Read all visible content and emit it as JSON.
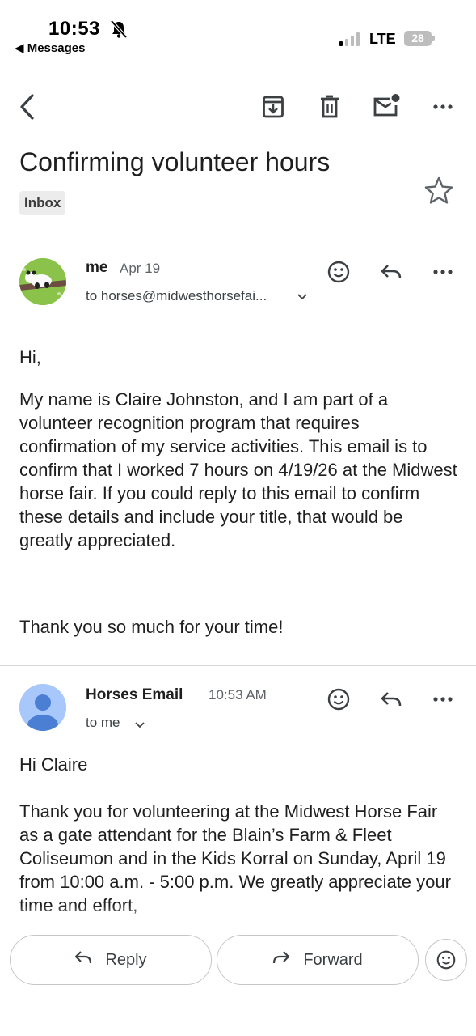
{
  "status_bar": {
    "time": "10:53",
    "back_app": "◀ Messages",
    "network": "LTE",
    "battery": "28"
  },
  "toolbar": {
    "back_icon": "back-arrow-icon",
    "archive_icon": "archive-icon",
    "delete_icon": "trash-icon",
    "unread_icon": "mark-unread-icon",
    "more_icon": "more-horizontal-icon"
  },
  "email": {
    "subject": "Confirming volunteer hours",
    "label": "Inbox"
  },
  "messages": [
    {
      "sender": "me",
      "date": "Apr 19",
      "to": "to horses@midwesthorsefai...",
      "body": [
        "Hi,",
        "My name is Claire Johnston, and I am part of a volunteer recognition program that requires confirmation of my service activities. This email is to confirm that I worked 7 hours on 4/19/26 at the Midwest horse fair. If you could reply to this email to confirm these details and include your title, that would be greatly appreciated.",
        "Thank you so much for your time!"
      ]
    },
    {
      "sender": "Horses Email",
      "date": "10:53 AM",
      "to": "to me",
      "body": [
        "Hi Claire",
        "Thank you for volunteering at the Midwest Horse Fair as a gate attendant for the Blain’s Farm & Fleet Coliseumon and in the Kids Korral on Sunday, April 19 from 10:00 a.m. - 5:00 p.m.  We greatly appreciate your time and effort,"
      ]
    }
  ],
  "bottom_bar": {
    "reply": "Reply",
    "forward": "Forward"
  },
  "colors": {
    "avatar_me": "#8bc34a",
    "avatar_default": "#a8c7fa",
    "avatar_person": "#4a7fd4"
  }
}
